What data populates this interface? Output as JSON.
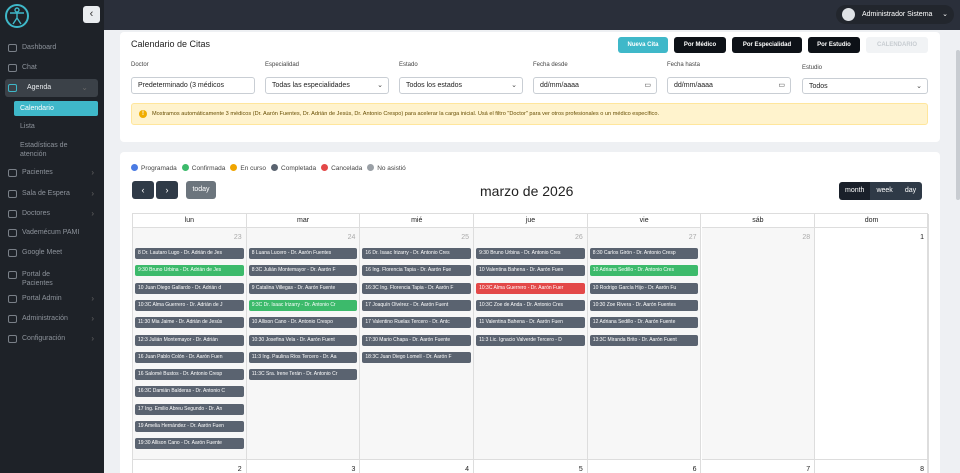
{
  "sidebar": {
    "items": [
      {
        "label": "Dashboard"
      },
      {
        "label": "Chat"
      },
      {
        "label": "Agenda"
      },
      {
        "label": "Pacientes"
      },
      {
        "label": "Sala de Espera"
      },
      {
        "label": "Doctores"
      },
      {
        "label": "Vademécum PAMI"
      },
      {
        "label": "Google Meet"
      },
      {
        "label": "Portal de Pacientes"
      },
      {
        "label": "Portal Admin"
      },
      {
        "label": "Administración"
      },
      {
        "label": "Configuración"
      }
    ],
    "submenu": [
      {
        "label": "Calendario"
      },
      {
        "label": "Lista"
      },
      {
        "label": "Estadísticas de atención"
      }
    ]
  },
  "topbar": {
    "user": "Administrador Sistema"
  },
  "filters": {
    "title": "Calendario de Citas",
    "buttons": [
      "Nueva Cita",
      "Por Médico",
      "Por Especialidad",
      "Por Estudio",
      "CALENDARIO"
    ],
    "medico_label": "Doctor",
    "medico_value": "Predeterminado (3 médicos",
    "especialidad_label": "Especialidad",
    "especialidad_value": "Todas las especialidades",
    "estado_label": "Estado",
    "estado_value": "Todos los estados",
    "desde_label": "Fecha desde",
    "desde_value": "dd/mm/aaaa",
    "hasta_label": "Fecha hasta",
    "hasta_value": "dd/mm/aaaa",
    "estudio_label": "Estudio",
    "estudio_value": "Todos",
    "alert": "Mostramos automáticamente 3 médicos (Dr. Aarón Fuentes, Dr. Adrián de Jesús, Dr. Antonio Crespo) para acelerar la carga inicial. Usá el filtro \"Doctor\" para ver otros profesionales o un médico específico."
  },
  "legend": [
    {
      "label": "Programada",
      "color": "#4a7be3"
    },
    {
      "label": "Confirmada",
      "color": "#3cba6b"
    },
    {
      "label": "En curso",
      "color": "#f0a500"
    },
    {
      "label": "Completada",
      "color": "#5a6370"
    },
    {
      "label": "Cancelada",
      "color": "#e34848"
    },
    {
      "label": "No asistió",
      "color": "#9aa0a6"
    }
  ],
  "calendar": {
    "title": "marzo de 2026",
    "today_label": "today",
    "prev": "‹",
    "next": "›",
    "views": [
      "month",
      "week",
      "day"
    ],
    "weekdays": [
      "lun",
      "mar",
      "mié",
      "jue",
      "vie",
      "sáb",
      "dom"
    ],
    "week1_days": [
      "23",
      "24",
      "25",
      "26",
      "27",
      "28",
      "1"
    ],
    "week2_days": [
      "2",
      "3",
      "4",
      "5",
      "6",
      "7",
      "8"
    ],
    "events": [
      [
        {
          "t": "8 Dr. Lautaro Lugo - Dr. Adrián de Jes",
          "c": "#5a6370"
        },
        {
          "t": "9:30 Bruno Urbina - Dr. Adrián de Jes",
          "c": "#3cba6b"
        },
        {
          "t": "10 Juan Diego Gallardo - Dr. Adrián d",
          "c": "#5a6370"
        },
        {
          "t": "10:3C Alma Guerrero - Dr. Adrián de J",
          "c": "#5a6370"
        },
        {
          "t": "11:30 Mia Jaime - Dr. Adrián de Jesús",
          "c": "#5a6370"
        },
        {
          "t": "12:3 Julián Montemayor - Dr. Adrián",
          "c": "#5a6370"
        },
        {
          "t": "16 Juan Pablo Colón - Dr. Aarón Fuen",
          "c": "#5a6370"
        },
        {
          "t": "16 Salomé Bustos - Dr. Antonio Cresp",
          "c": "#5a6370"
        },
        {
          "t": "16:3C Damián Balderas - Dr. Antonio C",
          "c": "#5a6370"
        },
        {
          "t": "17 Ing. Emilio Abreu Segundo - Dr. An",
          "c": "#5a6370"
        },
        {
          "t": "19 Amelia Hernández - Dr. Aarón Fuen",
          "c": "#5a6370"
        },
        {
          "t": "19:30 Allison Cano - Dr. Aarón Fuente",
          "c": "#5a6370"
        }
      ],
      [
        {
          "t": "8 Luana Lucero - Dr. Aarón Fuentes",
          "c": "#5a6370"
        },
        {
          "t": "8:3C Julián Montemayor - Dr. Aarón F",
          "c": "#5a6370"
        },
        {
          "t": "9 Catalina Villegas - Dr. Aarón Fuente",
          "c": "#5a6370"
        },
        {
          "t": "9:3C Dr. Isaac Irizarry - Dr. Antonio Cr",
          "c": "#3cba6b"
        },
        {
          "t": "10 Allison Cano - Dr. Antonio Crespo",
          "c": "#5a6370"
        },
        {
          "t": "10:30 Josefina Vela - Dr. Aarón Fuent",
          "c": "#5a6370"
        },
        {
          "t": "11:3 Ing. Paulina Ríos Tercero - Dr. Aa",
          "c": "#5a6370"
        },
        {
          "t": "11:3C Sra. Irene Terán - Dr. Antonio Cr",
          "c": "#5a6370"
        }
      ],
      [
        {
          "t": "16 Dr. Isaac Irizarry - Dr. Antonio Cres",
          "c": "#5a6370"
        },
        {
          "t": "16 Ing. Florencia Tapia - Dr. Aarón Fue",
          "c": "#5a6370"
        },
        {
          "t": "16:3C Ing. Florencia Tapia - Dr. Aarón F",
          "c": "#5a6370"
        },
        {
          "t": "17 Joaquín Olvérez - Dr. Aarón Fuent",
          "c": "#5a6370"
        },
        {
          "t": "17 Valentino Ruelas Tercero - Dr. Antc",
          "c": "#5a6370"
        },
        {
          "t": "17:30 Mario Chapa - Dr. Aarón Fuente",
          "c": "#5a6370"
        },
        {
          "t": "18:3C Juan Diego Lomelí - Dr. Aarón F",
          "c": "#5a6370"
        }
      ],
      [
        {
          "t": "9:30 Bruno Urbina - Dr. Antonio Cres",
          "c": "#5a6370"
        },
        {
          "t": "10 Valentina Bahena - Dr. Aarón Fuen",
          "c": "#5a6370"
        },
        {
          "t": "10:3C Alma Guerrero - Dr. Aarón Fuer",
          "c": "#e34848"
        },
        {
          "t": "10:3C Zoe de Anda - Dr. Antonio Cres",
          "c": "#5a6370"
        },
        {
          "t": "11 Valentina Bahena - Dr. Aarón Fuen",
          "c": "#5a6370"
        },
        {
          "t": "11:3 Lic. Ignacio Valverde Tercero - D",
          "c": "#5a6370"
        }
      ],
      [
        {
          "t": "8:30 Carlos Girón - Dr. Antonio Cresp",
          "c": "#5a6370"
        },
        {
          "t": "10 Adriana Sedillo - Dr. Antonio Cres",
          "c": "#3cba6b"
        },
        {
          "t": "10 Rodrigo García Hijo - Dr. Aarón Fu",
          "c": "#5a6370"
        },
        {
          "t": "10:30 Zoe Rivera - Dr. Aarón Fuentes",
          "c": "#5a6370"
        },
        {
          "t": "12 Adriana Sedillo - Dr. Aarón Fuente",
          "c": "#5a6370"
        },
        {
          "t": "13:3C Miranda Brito - Dr. Aarón Fuent",
          "c": "#5a6370"
        }
      ],
      [],
      []
    ]
  }
}
